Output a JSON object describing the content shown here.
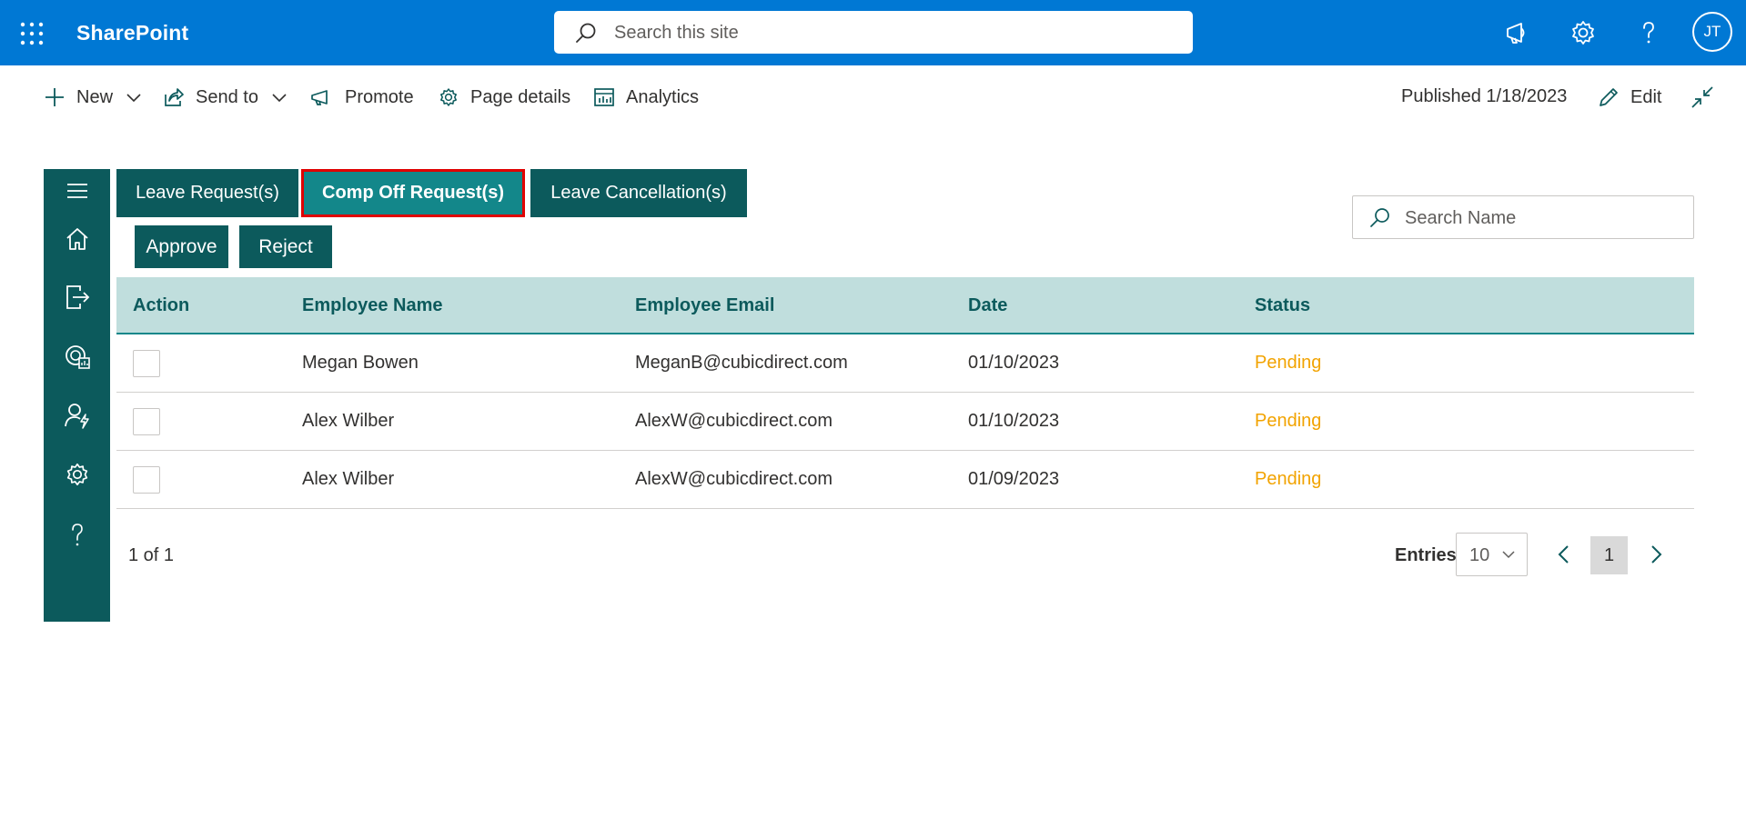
{
  "suite": {
    "brand": "SharePoint",
    "search_placeholder": "Search this site",
    "avatar_initials": "JT",
    "color": "#0078d4"
  },
  "commands": {
    "new": "New",
    "send_to": "Send to",
    "promote": "Promote",
    "page_details": "Page details",
    "analytics": "Analytics",
    "published": "Published 1/18/2023",
    "edit": "Edit"
  },
  "tabs": [
    {
      "label": "Leave Request(s)",
      "active": false
    },
    {
      "label": "Comp Off Request(s)",
      "active": true
    },
    {
      "label": "Leave Cancellation(s)",
      "active": false
    }
  ],
  "actions": {
    "approve": "Approve",
    "reject": "Reject"
  },
  "search": {
    "placeholder": "Search Name"
  },
  "table": {
    "columns": [
      "Action",
      "Employee Name",
      "Employee Email",
      "Date",
      "Status"
    ],
    "rows": [
      {
        "name": "Megan Bowen",
        "email": "MeganB@cubicdirect.com",
        "date": "01/10/2023",
        "status": "Pending"
      },
      {
        "name": "Alex Wilber",
        "email": "AlexW@cubicdirect.com",
        "date": "01/10/2023",
        "status": "Pending"
      },
      {
        "name": "Alex Wilber",
        "email": "AlexW@cubicdirect.com",
        "date": "01/09/2023",
        "status": "Pending"
      }
    ]
  },
  "pagination": {
    "info": "1 of 1",
    "entries_label": "Entries",
    "entries_value": "10",
    "current_page": "1"
  },
  "theme": {
    "teal_dark": "#0c5a5c",
    "teal_active": "#13878a",
    "header_bg": "#c0dedd",
    "pending": "#f2a300",
    "highlight_border": "#e00000"
  },
  "icons": {
    "rail": [
      "hamburger-icon",
      "home-icon",
      "sign-out-icon",
      "leave-icon",
      "user-approve-icon",
      "gear-icon",
      "help-icon"
    ]
  }
}
